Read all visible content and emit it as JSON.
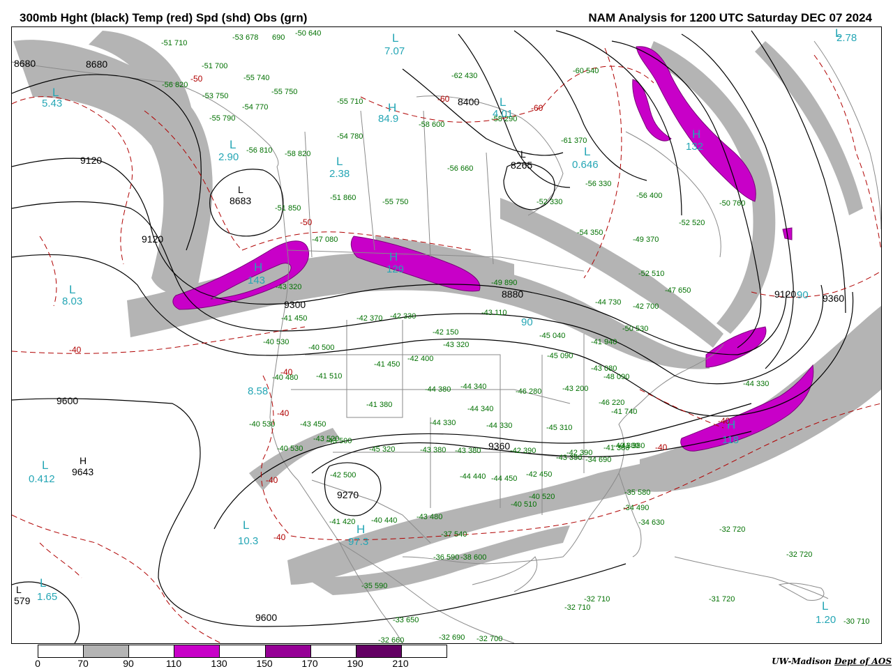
{
  "title_left": "300mb Hght (black) Temp (red) Spd (shd) Obs (grn)",
  "title_right": "NAM Analysis for 1200 UTC Saturday  DEC 07 2024",
  "colorbar": {
    "ticks": [
      "0",
      "70",
      "90",
      "110",
      "130",
      "150",
      "170",
      "190",
      "210"
    ],
    "colors": [
      "#ffffff",
      "#b4b4b4",
      "#ffffff",
      "#c800c8",
      "#ffffff",
      "#960096",
      "#ffffff",
      "#640064",
      "#ffffff"
    ]
  },
  "credit": {
    "org": "UW-Madison",
    "dept": "Dept of AOS"
  },
  "colors": {
    "jet_shade_70_90": "#b4b4b4",
    "jet_shade_110_130": "#c800c8",
    "height": "#000000",
    "temp": "#b00000",
    "obs": "#007000",
    "speed_labels": "#25a6b5"
  },
  "height_labels": [
    "8680",
    "8680",
    "9120",
    "8683",
    "9120",
    "9300",
    "8400",
    "8265",
    "8880",
    "9120",
    "9360",
    "9600",
    "9643",
    "9360",
    "9270",
    "9600",
    "579"
  ],
  "speed_labels": [
    "2.78",
    "5.43",
    "7.07",
    "2.90",
    "2.38",
    "84.9",
    "4.01",
    "0.646",
    "8.03",
    "143",
    "129",
    "90",
    "118",
    "90",
    "8.58",
    "0.412",
    "10.3",
    "97.3",
    "1.65",
    "1.20",
    "132"
  ],
  "speed_letters": [
    "L",
    "L",
    "L",
    "L",
    "H",
    "L",
    "L",
    "L",
    "H",
    "H",
    "H",
    "L",
    "L",
    "H",
    "L",
    "L",
    "H",
    "L"
  ],
  "height_letters": [
    "L",
    "L",
    "H",
    "L"
  ],
  "temp_labels": [
    "-50",
    "-60",
    "-60",
    "-50",
    "-40",
    "-40",
    "-40",
    "-40",
    "-40",
    "-40",
    "-40"
  ],
  "obs_labels": [
    "-51 710",
    "-53 678",
    "690",
    "-50 640",
    "-51 700",
    "-55 740",
    "-56 820",
    "-53 750",
    "-55 750",
    "-54 770",
    "-55 790",
    "-55 710",
    "-62 430",
    "-58 600",
    "-58 290",
    "-60 540",
    "-61 370",
    "-54 780",
    "-56 810",
    "-58 820",
    "-56 660",
    "-56 330",
    "-55 750",
    "-51 860",
    "-52 330",
    "-56 400",
    "-51 850",
    "-50 760",
    "-52 520",
    "-54 350",
    "-49 370",
    "-47 080",
    "-43 320",
    "-49 890",
    "-52 510",
    "-47 650",
    "-43 110",
    "-42 370",
    "-42 330",
    "-42 700",
    "-44 730",
    "-41 450",
    "-40 530",
    "-40 500",
    "-43 320",
    "-42 400",
    "-42 150",
    "-41 510",
    "-41 450",
    "-45 040",
    "-45 090",
    "-41 940",
    "-50 530",
    "-43 080",
    "-40 480",
    "-48 090",
    "-43 200",
    "-44 380",
    "-44 340",
    "-40 530",
    "-43 450",
    "-41 380",
    "-46 280",
    "-46 220",
    "-44 340",
    "-43 520",
    "-41 380",
    "-44 330",
    "-42 390",
    "-44 330",
    "-41 740",
    "-45 320",
    "-45 310",
    "-40 530",
    "-43 500",
    "-43 380",
    "-43 380",
    "-42 390",
    "-43 390",
    "-41 380",
    "-42 500",
    "-44 440",
    "-44 450",
    "-42 450",
    "-35 580",
    "-40 520",
    "-43 480",
    "-34 490",
    "-40 440",
    "-40 510",
    "-34 690",
    "-41 420",
    "-37 540",
    "-34 630",
    "-36 590",
    "-38 600",
    "-32 720",
    "-32 720",
    "-33 650",
    "-35 590",
    "-32 710",
    "-32 710",
    "-31 720",
    "-30 710",
    "-32 660",
    "-32 690",
    "-32 700",
    "-40 380",
    "-44 330"
  ]
}
